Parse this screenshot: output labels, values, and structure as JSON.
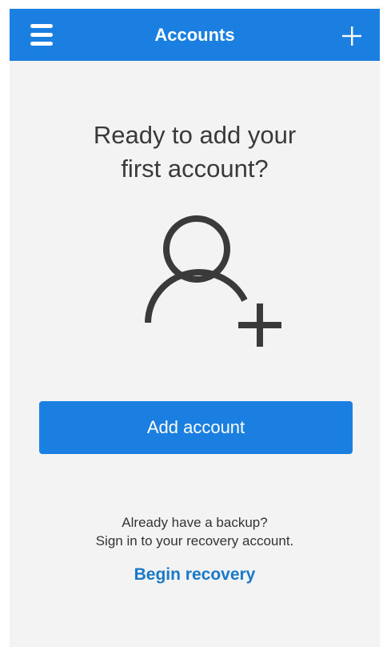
{
  "header": {
    "title": "Accounts",
    "menu_icon": "hamburger-menu-icon",
    "add_icon": "plus-icon"
  },
  "main": {
    "heading_line1": "Ready to add your",
    "heading_line2": "first account?",
    "illustration_icon": "add-person-icon",
    "add_button_label": "Add account",
    "backup_line1": "Already have a backup?",
    "backup_line2": "Sign in to your recovery account.",
    "recovery_link": "Begin recovery"
  },
  "colors": {
    "accent": "#1a7fe0",
    "background": "#f3f3f3",
    "link": "#1a78c8",
    "icon": "#3a3a3a"
  }
}
